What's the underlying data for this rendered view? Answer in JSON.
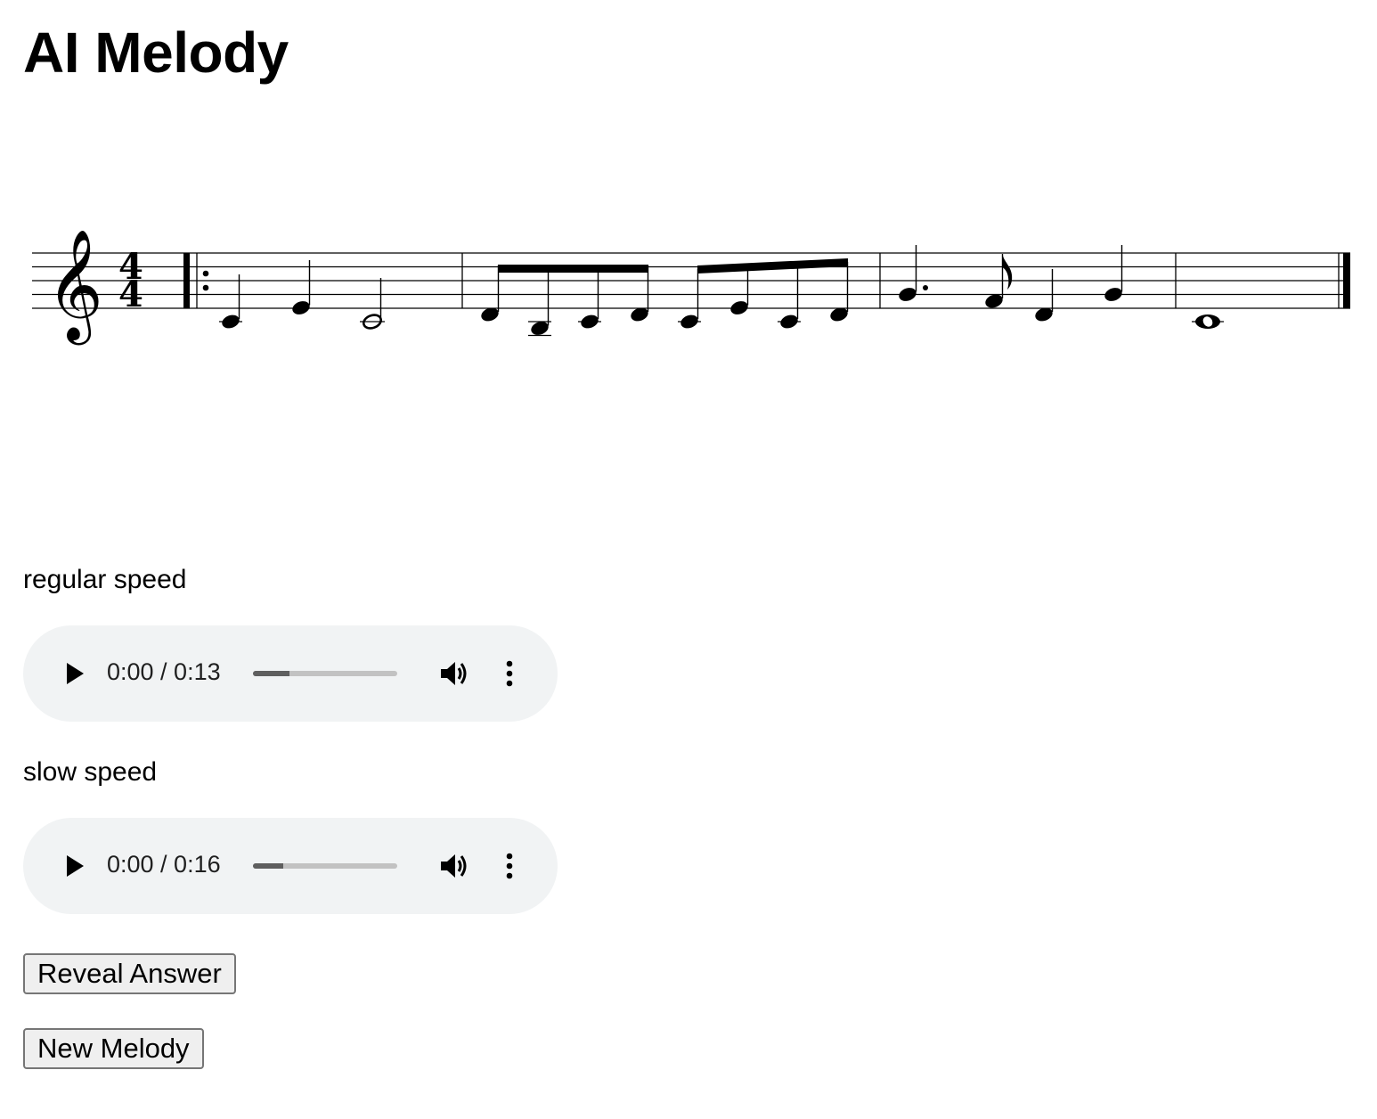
{
  "page": {
    "title": "AI Melody"
  },
  "score": {
    "clef": "treble",
    "time_signature": "4/4",
    "notes_per_measure": [
      [
        "C4 quarter",
        "E4 quarter",
        "C4 half"
      ],
      [
        "D4 eighth",
        "B3 eighth",
        "C4 eighth",
        "D4 eighth",
        "C4 eighth",
        "E4 eighth",
        "C4 eighth",
        "D4 eighth"
      ],
      [
        "G4 dotted-quarter",
        "F4 eighth",
        "D4 quarter",
        "G4 quarter"
      ],
      [
        "C4 whole"
      ]
    ]
  },
  "players": [
    {
      "label": "regular speed",
      "time": "0:00 / 0:13",
      "buffered": 0.25
    },
    {
      "label": "slow speed",
      "time": "0:00 / 0:16",
      "buffered": 0.21
    }
  ],
  "buttons": {
    "reveal": "Reveal Answer",
    "new_melody": "New Melody"
  },
  "icons": {
    "play": "play-icon",
    "volume": "volume-icon",
    "more": "more-vertical-icon"
  }
}
